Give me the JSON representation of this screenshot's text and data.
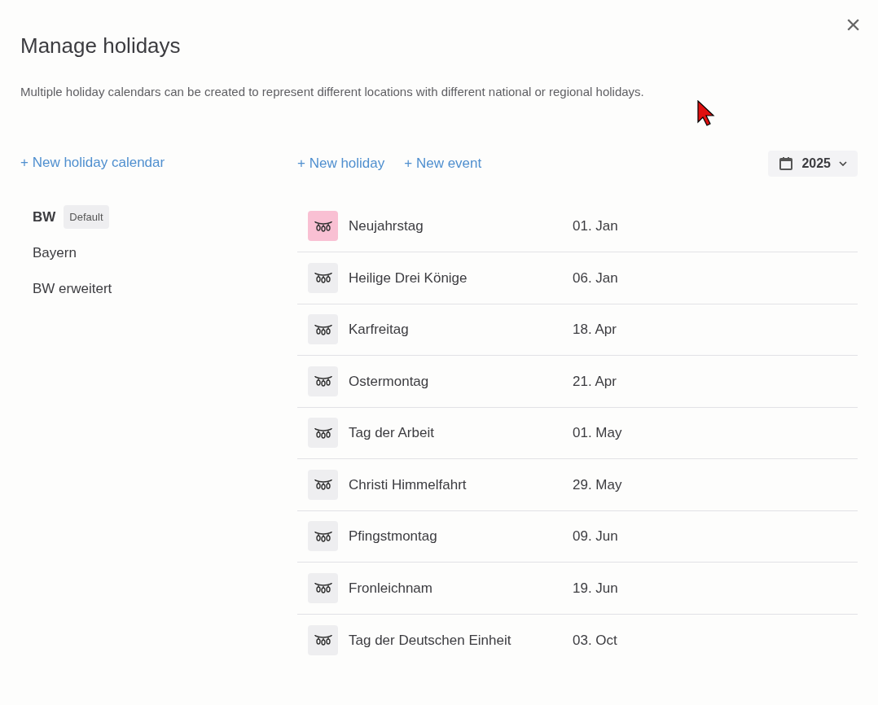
{
  "dialog": {
    "title": "Manage holidays",
    "description": "Multiple holiday calendars can be created to represent different locations with different national or regional holidays.",
    "close": "×"
  },
  "new_calendar_link": "+ New holiday calendar",
  "toolbar": {
    "new_holiday": "+ New holiday",
    "new_event": "+ New event",
    "year": "2025"
  },
  "calendars": [
    {
      "name": "BW",
      "badge": "Default",
      "selected": true
    },
    {
      "name": "Bayern",
      "selected": false
    },
    {
      "name": "BW erweitert",
      "selected": false
    }
  ],
  "holidays": [
    {
      "name": "Neujahrstag",
      "date": "01. Jan",
      "highlighted": true
    },
    {
      "name": "Heilige Drei Könige",
      "date": "06. Jan",
      "highlighted": false
    },
    {
      "name": "Karfreitag",
      "date": "18. Apr",
      "highlighted": false
    },
    {
      "name": "Ostermontag",
      "date": "21. Apr",
      "highlighted": false
    },
    {
      "name": "Tag der Arbeit",
      "date": "01. May",
      "highlighted": false
    },
    {
      "name": "Christi Himmelfahrt",
      "date": "29. May",
      "highlighted": false
    },
    {
      "name": "Pfingstmontag",
      "date": "09. Jun",
      "highlighted": false
    },
    {
      "name": "Fronleichnam",
      "date": "19. Jun",
      "highlighted": false
    },
    {
      "name": "Tag der Deutschen Einheit",
      "date": "03. Oct",
      "highlighted": false
    }
  ]
}
